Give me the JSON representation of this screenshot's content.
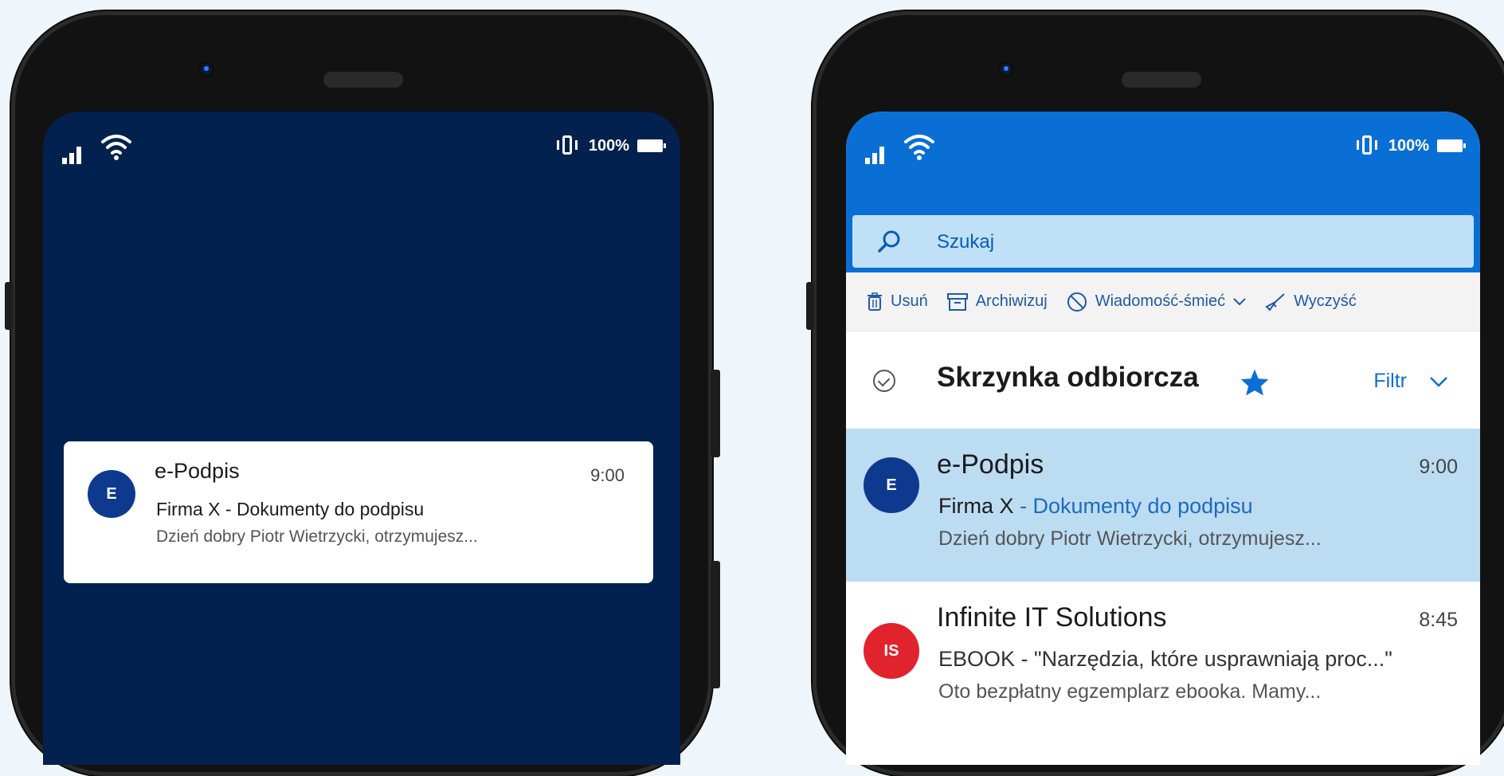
{
  "status": {
    "battery": "100%"
  },
  "lockscreen": {
    "notification": {
      "avatar": "E",
      "sender": "e-Podpis",
      "time": "9:00",
      "subject": "Firma X - Dokumenty do podpisu",
      "preview": "Dzień dobry Piotr Wietrzycki, otrzymujesz..."
    }
  },
  "outlook": {
    "search": {
      "placeholder": "Szukaj"
    },
    "toolbar": {
      "delete": "Usuń",
      "archive": "Archiwizuj",
      "junk": "Wiadomość-śmieć",
      "sweep": "Wyczyść"
    },
    "inbox": {
      "title": "Skrzynka odbiorcza",
      "filter": "Filtr"
    },
    "emails": [
      {
        "avatar": "E",
        "sender": "e-Podpis",
        "time": "9:00",
        "subject_strong": "Firma X",
        "subject_rest": " - Dokumenty do podpisu",
        "preview": "Dzień dobry Piotr Wietrzycki, otrzymujesz..."
      },
      {
        "avatar": "IS",
        "sender": "Infinite IT Solutions",
        "time": "8:45",
        "subject": "EBOOK - \"Narzędzia, które usprawniają proc...\"",
        "preview": "Oto bezpłatny egzemplarz ebooka. Mamy..."
      }
    ]
  },
  "colors": {
    "lock_bg": "#03214e",
    "outlook_blue": "#0a6fd4",
    "selected_row": "#bcdcf2",
    "avatar_blue": "#0d3a8f",
    "avatar_red": "#e1232e"
  }
}
